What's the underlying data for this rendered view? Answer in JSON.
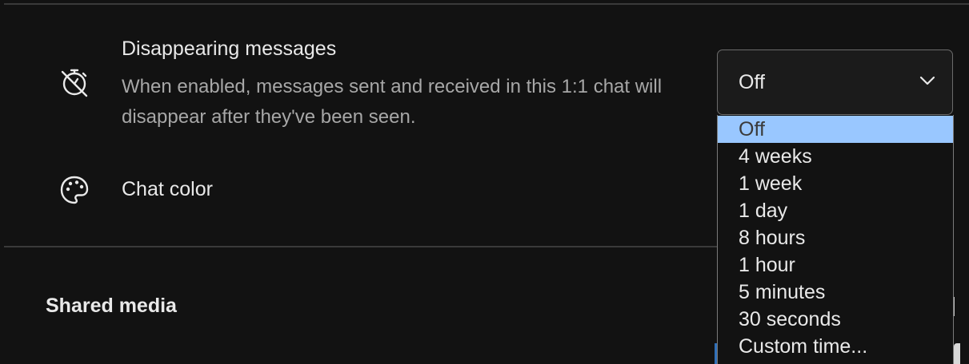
{
  "disappearing": {
    "title": "Disappearing messages",
    "description": "When enabled, messages sent and received in this 1:1 chat will disappear after they've been seen.",
    "icon": "timer-off-icon",
    "select": {
      "value": "Off",
      "options": [
        {
          "label": "Off",
          "selected": true
        },
        {
          "label": "4 weeks"
        },
        {
          "label": "1 week"
        },
        {
          "label": "1 day"
        },
        {
          "label": "8 hours"
        },
        {
          "label": "1 hour"
        },
        {
          "label": "5 minutes"
        },
        {
          "label": "30 seconds"
        },
        {
          "label": "Custom time..."
        }
      ]
    }
  },
  "chat_color": {
    "label": "Chat color",
    "icon": "palette-icon"
  },
  "shared_media": {
    "title": "Shared media"
  },
  "colors": {
    "background": "#121212",
    "selected_option": "#99c7ff",
    "muted_text": "#a7a7a7"
  }
}
